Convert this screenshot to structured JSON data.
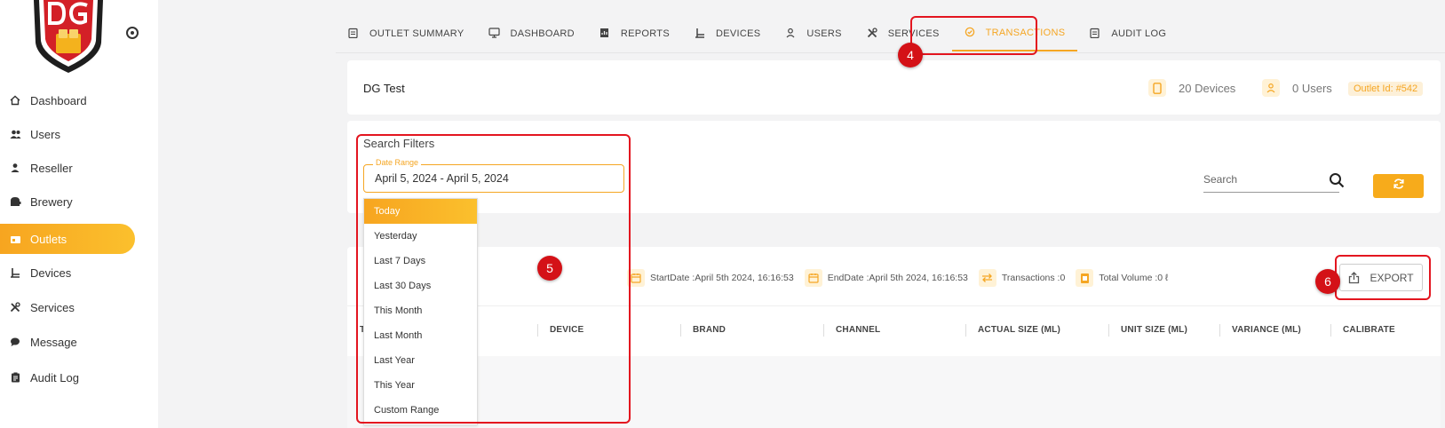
{
  "sidebar": {
    "items": [
      {
        "label": "Dashboard",
        "icon": "home-icon"
      },
      {
        "label": "Users",
        "icon": "users-icon"
      },
      {
        "label": "Reseller",
        "icon": "person-icon"
      },
      {
        "label": "Brewery",
        "icon": "brewery-icon"
      },
      {
        "label": "Outlets",
        "icon": "outlet-icon",
        "active": true
      },
      {
        "label": "Devices",
        "icon": "devices-icon"
      },
      {
        "label": "Services",
        "icon": "tools-icon"
      },
      {
        "label": "Message",
        "icon": "chat-icon"
      },
      {
        "label": "Audit Log",
        "icon": "clipboard-icon"
      }
    ]
  },
  "tabs": [
    {
      "label": "OUTLET SUMMARY",
      "icon": "clipboard-icon"
    },
    {
      "label": "DASHBOARD",
      "icon": "monitor-icon"
    },
    {
      "label": "REPORTS",
      "icon": "report-icon"
    },
    {
      "label": "DEVICES",
      "icon": "devices-icon"
    },
    {
      "label": "USERS",
      "icon": "person-icon"
    },
    {
      "label": "SERVICES",
      "icon": "tools-icon"
    },
    {
      "label": "TRANSACTIONS",
      "icon": "transactions-icon",
      "active": true
    },
    {
      "label": "AUDIT LOG",
      "icon": "clipboard-icon"
    }
  ],
  "outlet": {
    "name": "DG Test",
    "devices": "20 Devices",
    "users": "0 Users",
    "outlet_id": "Outlet Id: #542"
  },
  "filters": {
    "title": "Search Filters",
    "date_range_label": "Date Range",
    "date_range_value": "April 5, 2024 - April 5, 2024",
    "search_placeholder": "Search"
  },
  "date_presets": [
    "Today",
    "Yesterday",
    "Last 7 Days",
    "Last 30 Days",
    "This Month",
    "Last Month",
    "Last Year",
    "This Year",
    "Custom Range"
  ],
  "summary": {
    "start": "StartDate :April 5th 2024, 16:16:53",
    "end": "EndDate :April 5th 2024, 16:16:53",
    "transactions": "Transactions :0",
    "volume": "Total Volume :0 ℓ"
  },
  "export_label": "EXPORT",
  "table": {
    "first_col_fragment": "T",
    "columns": [
      "DEVICE",
      "BRAND",
      "CHANNEL",
      "ACTUAL SIZE (ML)",
      "UNIT SIZE (ML)",
      "VARIANCE (ML)",
      "CALIBRATE"
    ]
  },
  "annotations": [
    "4",
    "5",
    "6"
  ],
  "colors": {
    "accent": "#f7ab1b",
    "annotation": "#e3151f",
    "logo_red": "#d32027"
  }
}
